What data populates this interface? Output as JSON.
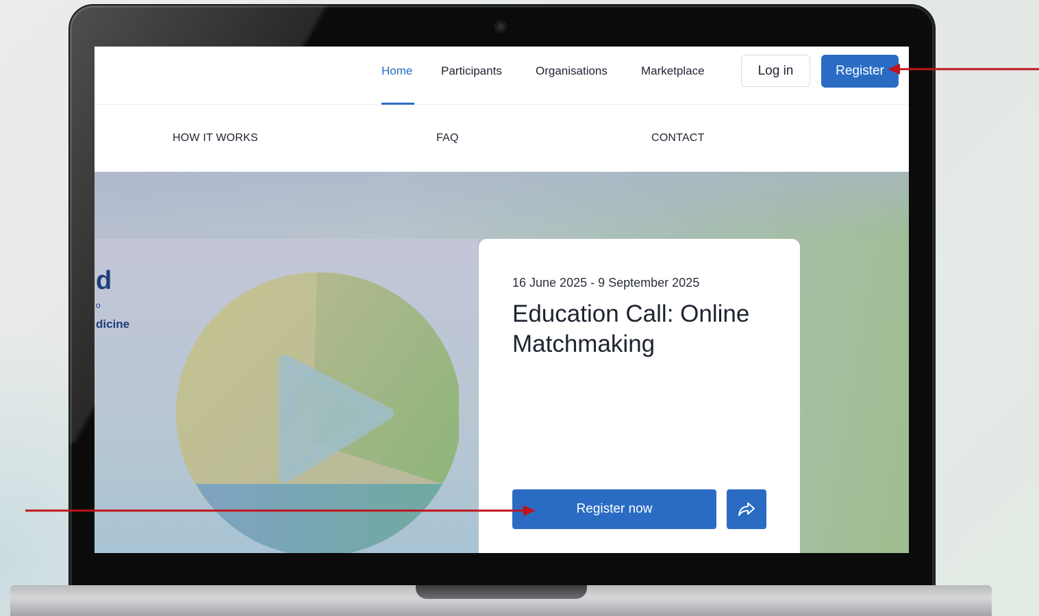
{
  "topnav": {
    "items": [
      {
        "label": "Home",
        "active": true
      },
      {
        "label": "Participants",
        "active": false
      },
      {
        "label": "Organisations",
        "active": false
      },
      {
        "label": "Marketplace",
        "active": false
      }
    ],
    "login_label": "Log in",
    "register_label": "Register"
  },
  "subnav": {
    "items": [
      "HOW IT WORKS",
      "FAQ",
      "CONTACT"
    ]
  },
  "hero": {
    "text_big": "d",
    "text_tiny": "o",
    "text_small": "dicine"
  },
  "event_card": {
    "date_range": "16 June 2025 - 9 September 2025",
    "title": "Education Call: Online Matchmaking",
    "register_now_label": "Register now",
    "share_icon": "share-icon"
  },
  "colors": {
    "accent": "#2a6cc4",
    "annotation_arrow": "#c0141c",
    "heading_blue": "#1e3d7a"
  }
}
